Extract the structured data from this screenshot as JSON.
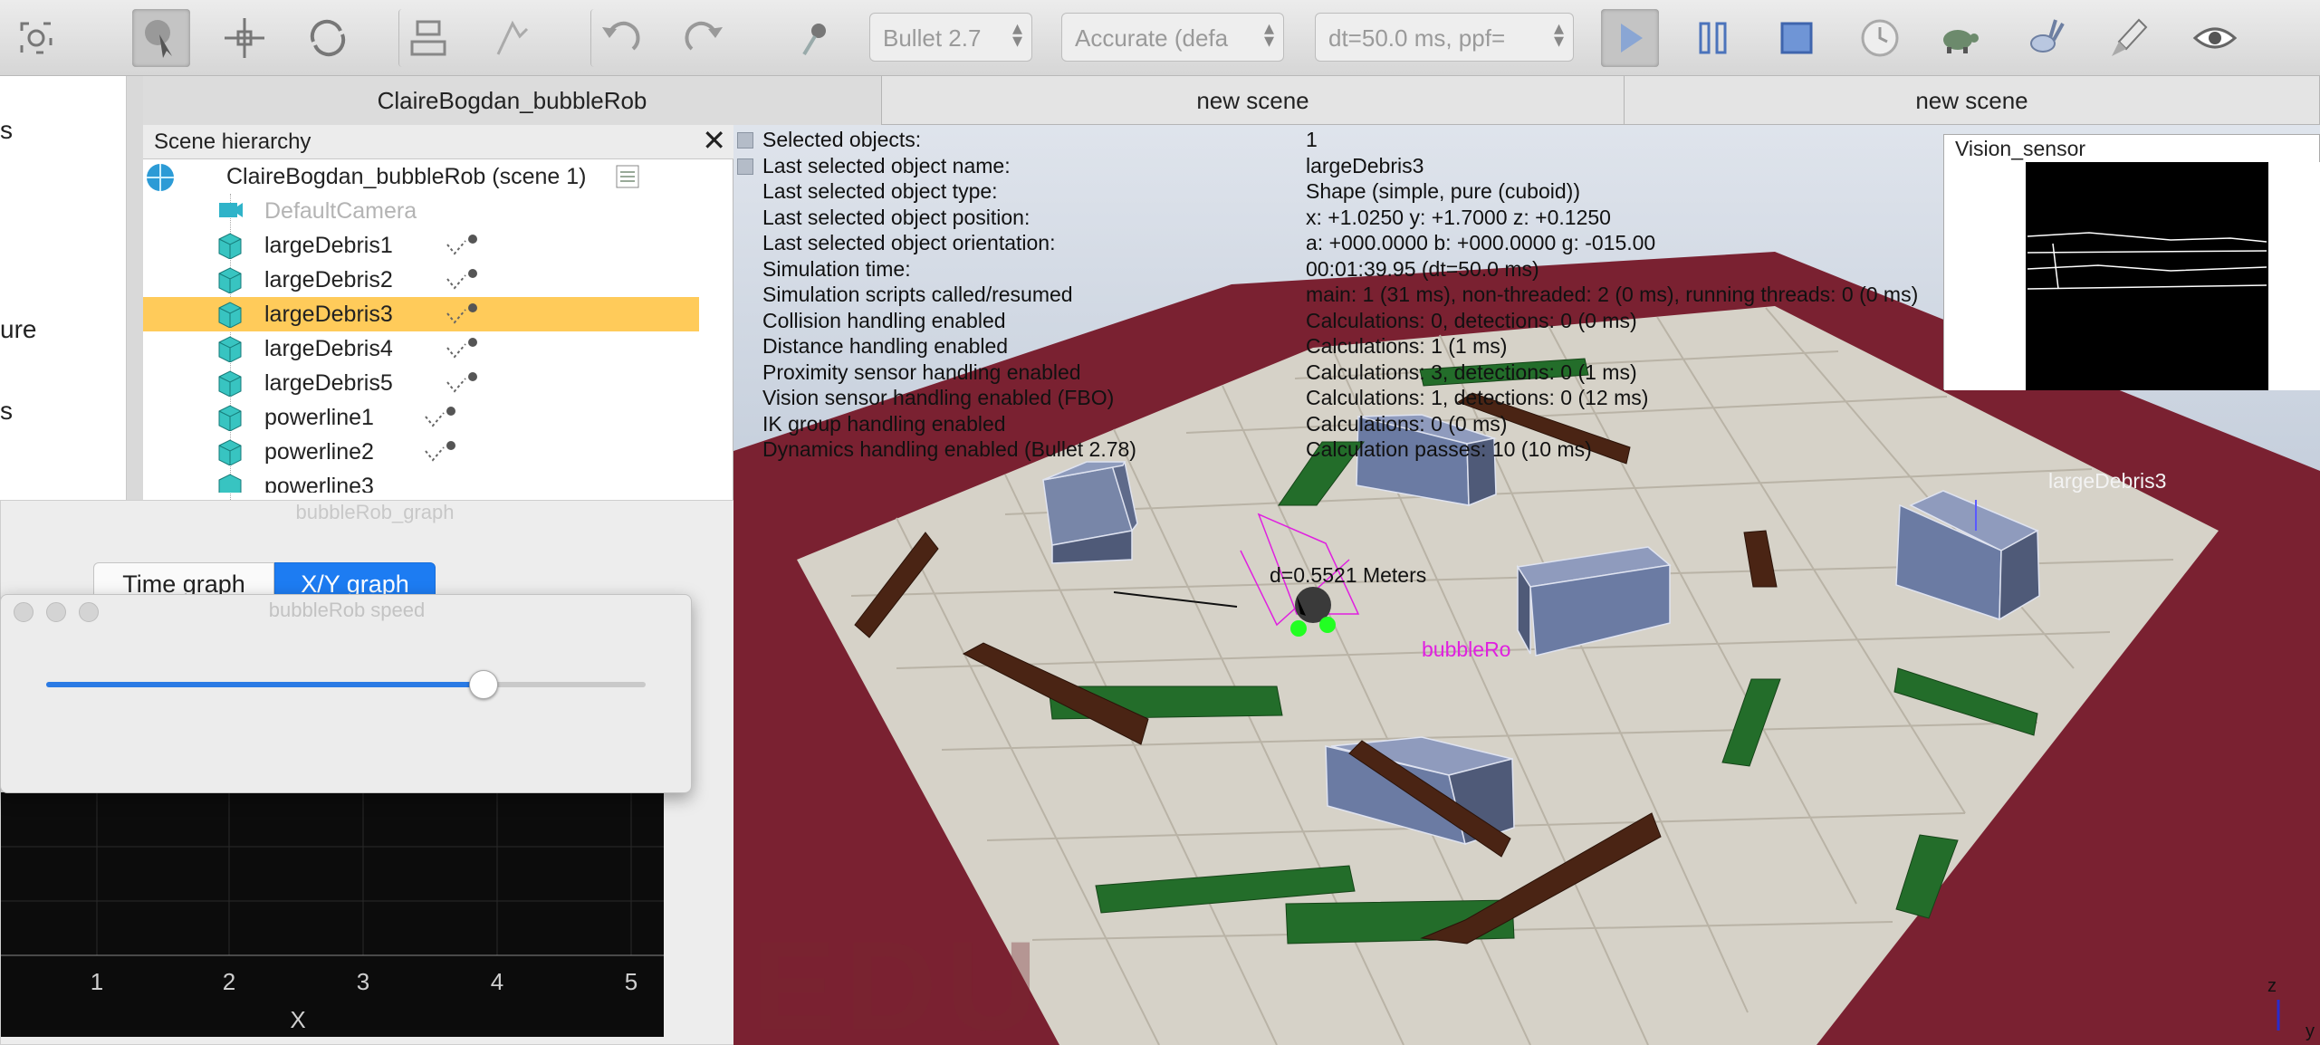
{
  "toolbar": {
    "engine": "Bullet 2.7",
    "accuracy": "Accurate (defa",
    "timestep": "dt=50.0 ms, ppf="
  },
  "left_strip": {
    "fragments": [
      "s",
      "ure",
      "s"
    ]
  },
  "tabs": [
    {
      "label": "ClaireBogdan_bubbleRob"
    },
    {
      "label": "new scene"
    },
    {
      "label": "new scene"
    }
  ],
  "hierarchy": {
    "title": "Scene hierarchy",
    "close": "✕",
    "root": "ClaireBogdan_bubbleRob (scene 1)",
    "items": [
      {
        "label": "DefaultCamera"
      },
      {
        "label": "largeDebris1"
      },
      {
        "label": "largeDebris2"
      },
      {
        "label": "largeDebris3"
      },
      {
        "label": "largeDebris4"
      },
      {
        "label": "largeDebris5"
      },
      {
        "label": "powerline1"
      },
      {
        "label": "powerline2"
      },
      {
        "label": "powerline3"
      }
    ]
  },
  "graph": {
    "title": "bubbleRob_graph",
    "tab_time": "Time graph",
    "tab_xy": "X/Y graph",
    "x_ticks": [
      "1",
      "2",
      "3",
      "4",
      "5"
    ],
    "x_label": "X"
  },
  "speed_dialog": {
    "title": "bubbleRob speed",
    "slider_fraction": 0.73
  },
  "info": [
    {
      "label": "Selected objects:",
      "value": "1"
    },
    {
      "label": "Last selected object name:",
      "value": "largeDebris3"
    },
    {
      "label": "Last selected object type:",
      "value": "Shape (simple, pure (cuboid))"
    },
    {
      "label": "Last selected object position:",
      "value": "x: +1.0250    y: +1.7000    z: +0.1250"
    },
    {
      "label": "Last selected object orientation:",
      "value": "a: +000.0000    b: +000.0000    g: -015.00"
    },
    {
      "label": "Simulation time:",
      "value": "00:01:39.95 (dt=50.0 ms)"
    },
    {
      "label": "Simulation scripts called/resumed",
      "value": "main: 1 (31 ms), non-threaded: 2 (0 ms), running threads: 0 (0 ms)"
    },
    {
      "label": "Collision handling enabled",
      "value": "Calculations: 0, detections: 0 (0 ms)"
    },
    {
      "label": "Distance handling enabled",
      "value": "Calculations: 1 (1 ms)"
    },
    {
      "label": "Proximity sensor handling enabled",
      "value": "Calculations: 3, detections: 0 (1 ms)"
    },
    {
      "label": "Vision sensor handling enabled (FBO)",
      "value": "Calculations: 1, detections: 0 (12 ms)"
    },
    {
      "label": "IK group handling enabled",
      "value": "Calculations: 0 (0 ms)"
    },
    {
      "label": "Dynamics handling enabled (Bullet 2.78)",
      "value": "Calculation passes: 10 (10 ms)"
    }
  ],
  "vision_sensor": {
    "title": "Vision_sensor"
  },
  "annotations": {
    "selected_label": "largeDebris3",
    "distance": "d=0.5521 Meters",
    "robot_label": "bubbleRo",
    "watermark": "EDU",
    "axis_z": "z",
    "axis_y": "y"
  },
  "colors": {
    "selection": "#ffcb5a",
    "accent": "#1d7cf2",
    "wall": "#7a2131",
    "box": "#6b7ba3",
    "bar_green": "#236d2a",
    "bar_brown": "#4a2414",
    "robot_label": "#e020e0"
  }
}
